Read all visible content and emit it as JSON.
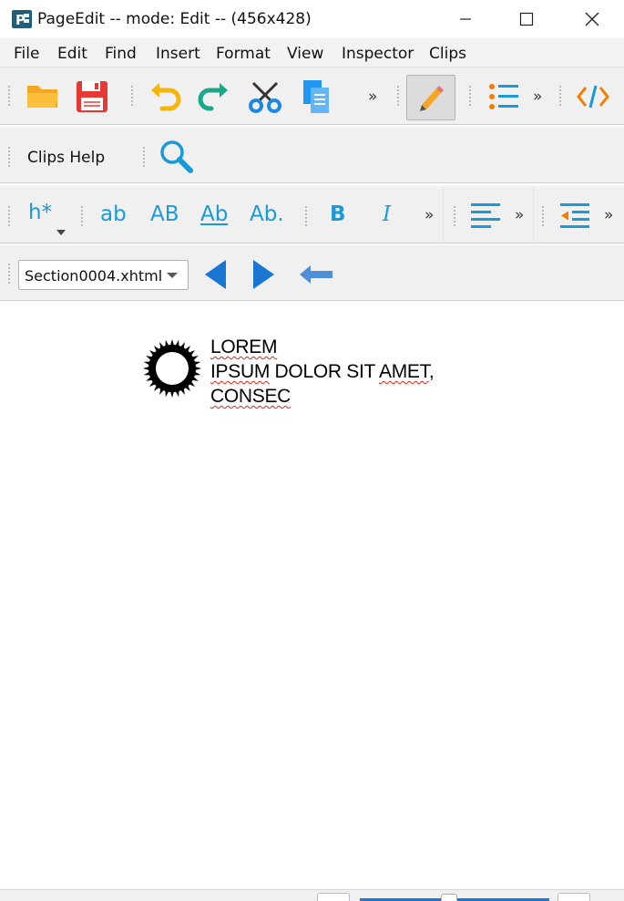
{
  "window": {
    "title": "PageEdit -- mode: Edit -- (456x428)",
    "controls": [
      "minimize",
      "maximize",
      "close"
    ]
  },
  "menu": {
    "items": [
      "File",
      "Edit",
      "Find",
      "Insert",
      "Format",
      "View",
      "Inspector",
      "Clips"
    ]
  },
  "toolbar_main": {
    "buttons": [
      "open-folder-icon",
      "save-icon",
      "undo-icon",
      "redo-icon",
      "cut-icon",
      "copy-icon",
      "edit-pencil-icon",
      "list-icon",
      "code-view-icon"
    ],
    "overflow": "»",
    "active": "edit-pencil-icon"
  },
  "toolbar_clips": {
    "label": "Clips Help",
    "search_icon": "search-icon"
  },
  "toolbar_format": {
    "heading": "h*",
    "lowercase": "ab",
    "uppercase": "AB",
    "capitalize": "Ab",
    "sentence": "Ab.",
    "bold": "B",
    "italic": "I",
    "overflow": "»"
  },
  "toolbar_nav": {
    "section_select": "Section0004.xhtml",
    "prev_icon": "previous-arrow-icon",
    "next_icon": "next-arrow-icon",
    "back_icon": "back-arrow-icon"
  },
  "document": {
    "image": "sun-logo-icon",
    "line1": "LOREM",
    "line2_a": "IPSUM",
    "line2_b": " DOLOR SIT ",
    "line2_c": "AMET",
    "line2_d": ",",
    "line3": "CONSEC"
  },
  "colors": {
    "accent_blue": "#1a9ad6",
    "nav_blue": "#1976d2",
    "pencil_orange": "#f5a623",
    "spell_red": "#dd1111"
  }
}
